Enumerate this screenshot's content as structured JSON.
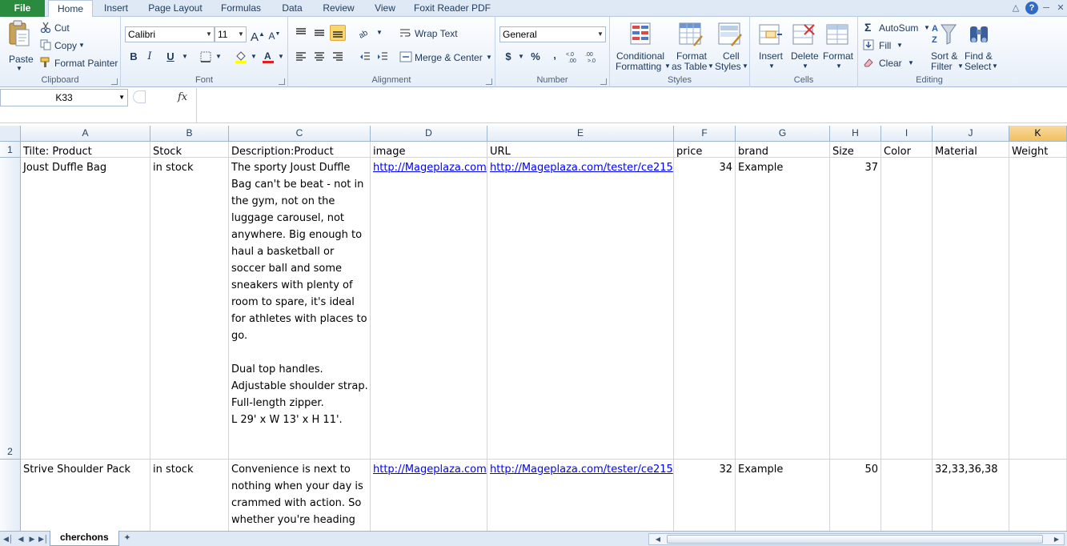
{
  "tabs": {
    "file": "File",
    "home": "Home",
    "insert": "Insert",
    "page_layout": "Page Layout",
    "formulas": "Formulas",
    "data": "Data",
    "review": "Review",
    "view": "View",
    "foxit": "Foxit Reader PDF"
  },
  "ribbon": {
    "clipboard": {
      "label": "Clipboard",
      "paste": "Paste",
      "cut": "Cut",
      "copy": "Copy",
      "format_painter": "Format Painter"
    },
    "font": {
      "label": "Font",
      "font_name": "Calibri",
      "font_size": "11",
      "bold": "B",
      "italic": "I",
      "underline": "U"
    },
    "alignment": {
      "label": "Alignment",
      "wrap_text": "Wrap Text",
      "merge_center": "Merge & Center"
    },
    "number": {
      "label": "Number",
      "format": "General",
      "currency": "$",
      "percent": "%",
      "comma": ","
    },
    "styles": {
      "label": "Styles",
      "conditional_1": "Conditional",
      "conditional_2": "Formatting",
      "format_table_1": "Format",
      "format_table_2": "as Table",
      "cell_styles_1": "Cell",
      "cell_styles_2": "Styles"
    },
    "cells": {
      "label": "Cells",
      "insert": "Insert",
      "delete": "Delete",
      "format": "Format"
    },
    "editing": {
      "label": "Editing",
      "autosum": "AutoSum",
      "fill": "Fill",
      "clear": "Clear",
      "sort_1": "Sort &",
      "sort_2": "Filter",
      "find_1": "Find &",
      "find_2": "Select"
    }
  },
  "formula_bar": {
    "name_box": "K33",
    "fx": "fx",
    "content": ""
  },
  "columns": [
    "A",
    "B",
    "C",
    "D",
    "E",
    "F",
    "G",
    "H",
    "I",
    "J",
    "K"
  ],
  "selected_column": "K",
  "rows": [
    {
      "num": "1",
      "cells": [
        "Tilte: Product",
        "Stock",
        "Description:Product",
        "image",
        "URL",
        "price",
        "brand",
        "Size",
        "Color",
        "Material",
        "Weight"
      ]
    },
    {
      "num": "2",
      "cells": [
        "Joust Duffle Bag",
        "in stock",
        "The sporty Joust Duffle Bag can't be beat - not in the gym, not on the luggage carousel, not anywhere. Big enough to haul a basketball or soccer ball and some sneakers with plenty of room to spare, it's ideal for athletes with places to go.\n\nDual top handles.\nAdjustable shoulder strap.\nFull-length zipper.\nL 29' x W 13' x H 11'.",
        "http://Mageplaza.com",
        "http://Mageplaza.com/tester/ce215",
        "34",
        "Example",
        "37",
        "",
        "",
        ""
      ]
    },
    {
      "num": "",
      "cells": [
        "Strive Shoulder Pack",
        "in stock",
        "Convenience is next to nothing when your day is crammed with action. So whether you're heading to",
        "http://Mageplaza.com",
        "http://Mageplaza.com/tester/ce215",
        "32",
        "Example",
        "50",
        "",
        "32,33,36,38",
        ""
      ]
    }
  ],
  "sheet": {
    "name": "cherchons"
  }
}
